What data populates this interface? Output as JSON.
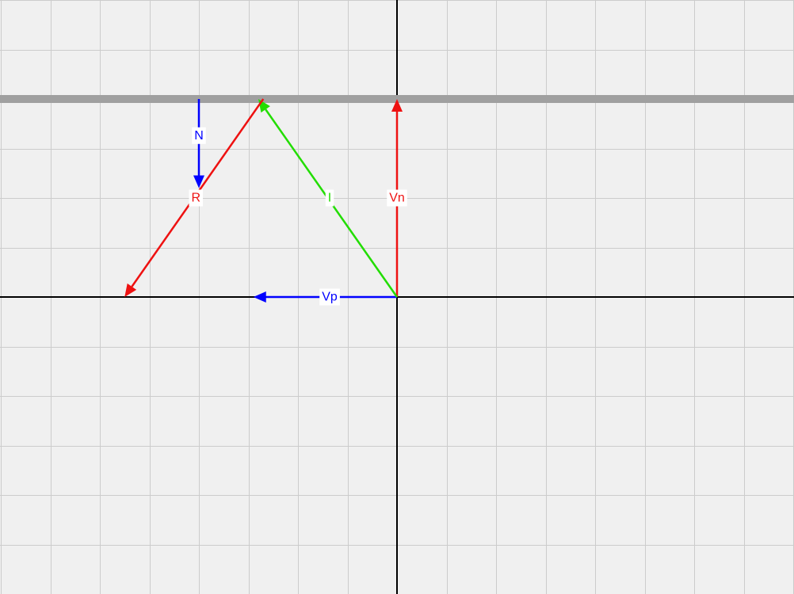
{
  "canvas": {
    "background": "#f0f0f0",
    "grid_color": "#cccccc",
    "axis_color": "#000000",
    "surface_color": "#a0a0a0"
  },
  "units": {
    "x_range": [
      -4,
      4
    ],
    "y_range": [
      -3,
      3
    ],
    "grid_step": 0.5,
    "surface_y": 2
  },
  "vectors": [
    {
      "id": "vp",
      "label": "Vp",
      "color": "#0000ff",
      "from": [
        0,
        0
      ],
      "to": [
        -1.45,
        0
      ],
      "label_pos": [
        -0.68,
        0
      ]
    },
    {
      "id": "vn",
      "label": "Vn",
      "color": "#ee1111",
      "from": [
        0,
        0
      ],
      "to": [
        0,
        2
      ],
      "label_pos": [
        0,
        1
      ]
    },
    {
      "id": "i",
      "label": "I",
      "color": "#22dd00",
      "from": [
        0,
        0
      ],
      "to": [
        -1.4,
        2
      ],
      "label_pos": [
        -0.68,
        1
      ]
    },
    {
      "id": "r",
      "label": "R",
      "color": "#ee1111",
      "from": [
        -1.35,
        2
      ],
      "to": [
        -2.75,
        0
      ],
      "label_pos": [
        -2.03,
        1
      ]
    },
    {
      "id": "n",
      "label": "N",
      "color": "#0000ff",
      "from": [
        -2,
        2
      ],
      "to": [
        -2,
        1.1
      ],
      "label_pos": [
        -2,
        1.63
      ]
    }
  ]
}
